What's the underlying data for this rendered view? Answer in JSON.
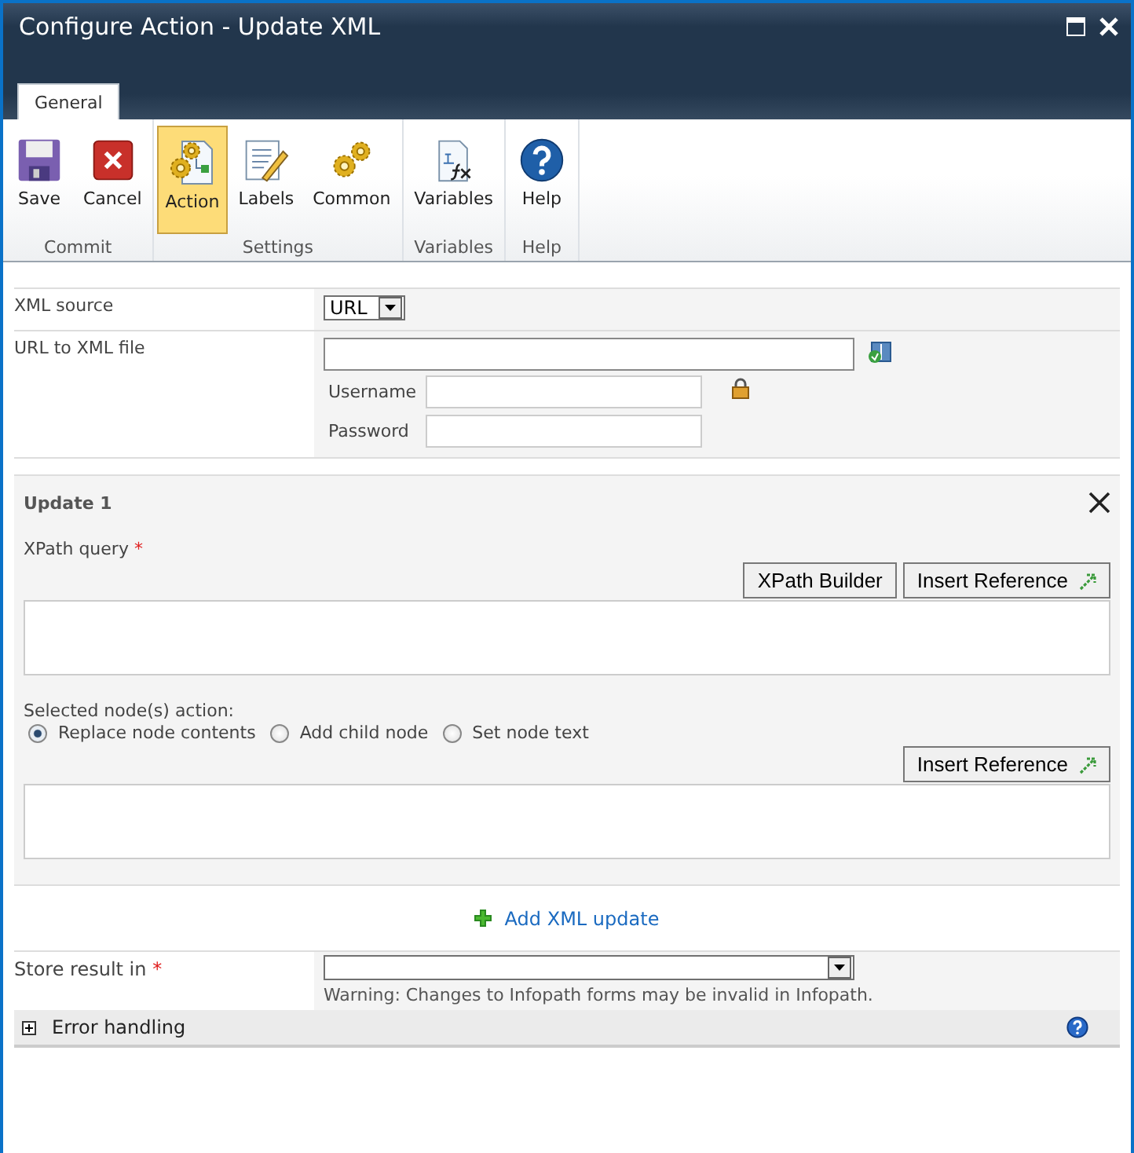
{
  "window": {
    "title": "Configure Action - Update XML"
  },
  "tabs": [
    {
      "label": "General",
      "selected": true
    }
  ],
  "ribbon": {
    "groups": [
      {
        "label": "Commit",
        "buttons": [
          {
            "label": "Save",
            "kind": "save",
            "selected": false
          },
          {
            "label": "Cancel",
            "kind": "cancel",
            "selected": false
          }
        ]
      },
      {
        "label": "Settings",
        "buttons": [
          {
            "label": "Action",
            "kind": "action",
            "selected": true
          },
          {
            "label": "Labels",
            "kind": "labels",
            "selected": false
          },
          {
            "label": "Common",
            "kind": "common",
            "selected": false
          }
        ]
      },
      {
        "label": "Variables",
        "buttons": [
          {
            "label": "Variables",
            "kind": "variables",
            "selected": false
          }
        ]
      },
      {
        "label": "Help",
        "buttons": [
          {
            "label": "Help",
            "kind": "help",
            "selected": false
          }
        ]
      }
    ]
  },
  "xml_source": {
    "label": "XML source",
    "value": "URL"
  },
  "url": {
    "label": "URL to XML file",
    "username_label": "Username",
    "password_label": "Password"
  },
  "update": {
    "title": "Update 1",
    "xpath_label": "XPath query",
    "required_mark": "*",
    "buttons": [
      "XPath Builder",
      "Insert Reference"
    ],
    "action_label": "Selected node(s) action:",
    "options": [
      {
        "label": "Replace node contents",
        "selected": true
      },
      {
        "label": "Add child node",
        "selected": false
      },
      {
        "label": "Set node text",
        "selected": false
      }
    ],
    "value_button": "Insert Reference"
  },
  "add_link": "Add XML update",
  "store": {
    "label": "Store result in",
    "required_mark": "*",
    "warning": "Warning: Changes to Infopath forms may be invalid in Infopath."
  },
  "error_handling": {
    "label": "Error handling",
    "expanded": false
  }
}
